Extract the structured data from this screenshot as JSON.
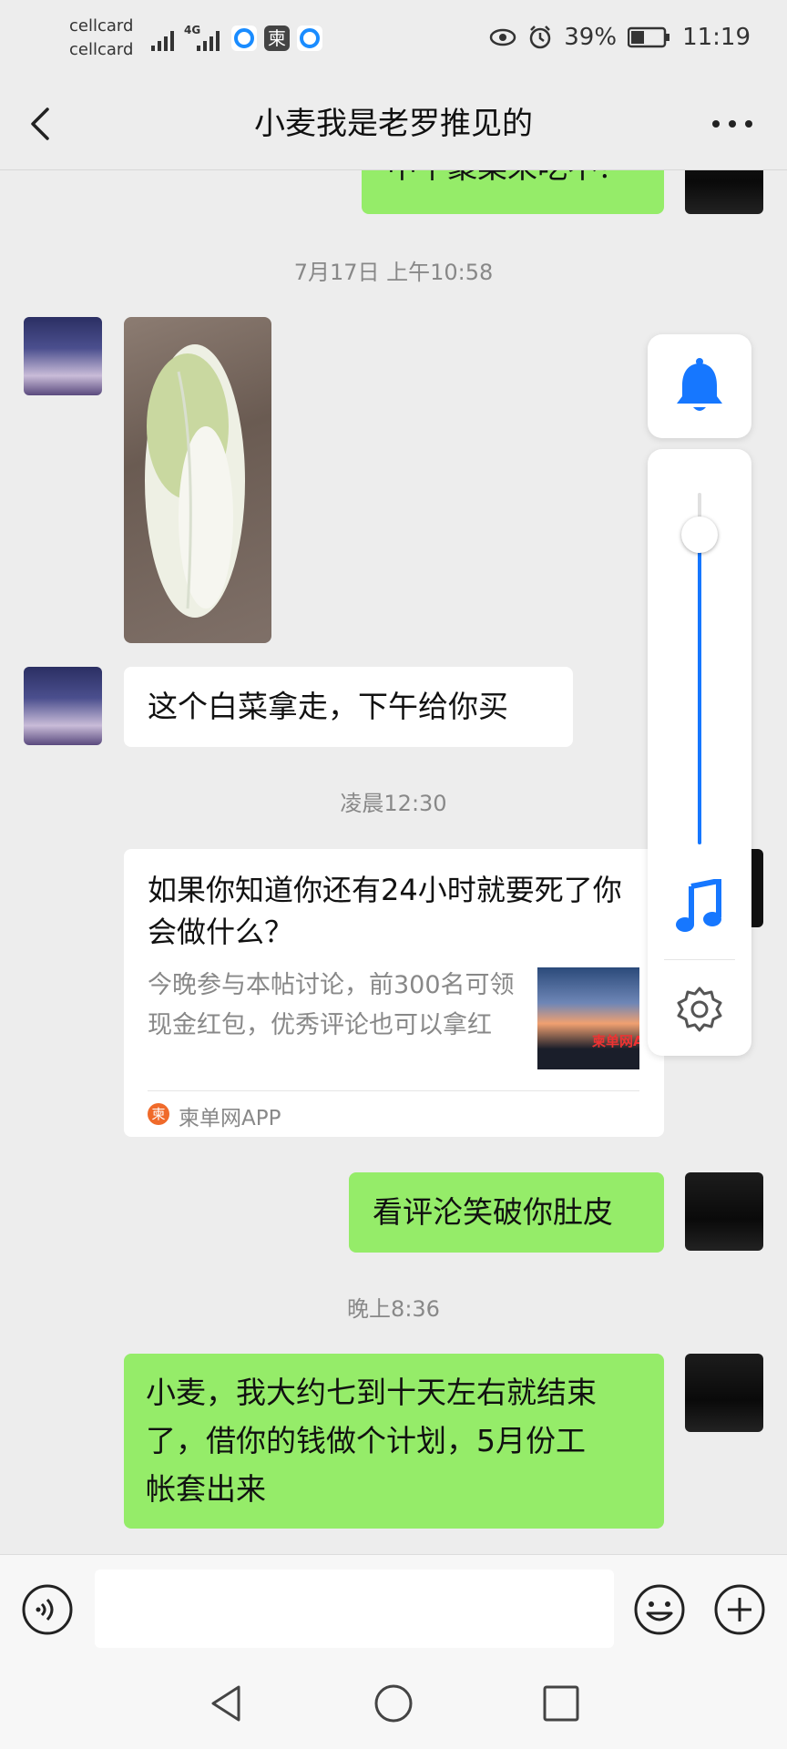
{
  "status_bar": {
    "carrier1": "cellcard",
    "carrier2": "cellcard",
    "network": "4G",
    "battery": "39%",
    "time": "11:19",
    "app_badge": "柬"
  },
  "header": {
    "title": "小麦我是老罗推见的"
  },
  "messages": {
    "partial_top": "中午聚菜来吃不？",
    "ts1": "7月17日 上午10:58",
    "other_text": "这个白菜拿走，下午给你买",
    "ts2": "凌晨12:30",
    "card": {
      "title": "如果你知道你还有24小时就要死了你会做什么？",
      "desc": "今晚参与本帖讨论，前300名可领现金红包，优秀评论也可以拿红",
      "source": "柬单网APP",
      "source_icon_char": "柬",
      "thumb_text": "柬单网A"
    },
    "me_text1": "看评沦笑破你肚皮",
    "ts3": "晚上8:36",
    "me_text2_lines": [
      "小麦，我大约七到十天左右就结束",
      "了，借你的钱做个计划，5月份工",
      "帐套出来"
    ]
  },
  "volume_panel": {
    "level": 0.88
  },
  "colors": {
    "accent_blue": "#1677ff",
    "bubble_green": "#95ec69"
  }
}
